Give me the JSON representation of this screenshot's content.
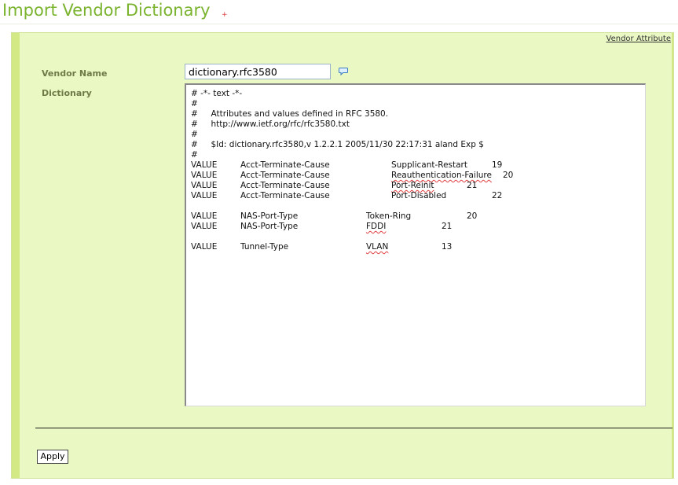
{
  "page": {
    "title": "Import Vendor Dictionary",
    "required_marker": "+"
  },
  "panel": {
    "vendor_attribute_link": "Vendor Attribute",
    "vendor_name_label": "Vendor Name",
    "vendor_name_value": "dictionary.rfc3580",
    "dictionary_label": "Dictionary",
    "dictionary_lines": [
      "# -*- text -*-",
      "#",
      "#     Attributes and values defined in RFC 3580.",
      "#     http://www.ietf.org/rfc/rfc3580.txt",
      "#",
      "#     $Id: dictionary.rfc3580,v 1.2.2.1 2005/11/30 22:17:31 aland Exp $",
      "#"
    ],
    "value_rows_terminate": [
      {
        "kw": "VALUE",
        "attr": "Acct-Terminate-Cause",
        "name": "Supplicant-Restart",
        "num": "19"
      },
      {
        "kw": "VALUE",
        "attr": "Acct-Terminate-Cause",
        "name": "Reauthentication-Failure",
        "num": "20"
      },
      {
        "kw": "VALUE",
        "attr": "Acct-Terminate-Cause",
        "name": "Port-Reinit",
        "num": "21"
      },
      {
        "kw": "VALUE",
        "attr": "Acct-Terminate-Cause",
        "name": "Port-Disabled",
        "num": "22"
      }
    ],
    "value_rows_nas": [
      {
        "kw": "VALUE",
        "attr": "NAS-Port-Type",
        "name": "Token-Ring",
        "num": "20"
      },
      {
        "kw": "VALUE",
        "attr": "NAS-Port-Type",
        "name": "FDDI",
        "num": "21"
      }
    ],
    "value_rows_tunnel": [
      {
        "kw": "VALUE",
        "attr": "Tunnel-Type",
        "name": "VLAN",
        "num": "13"
      }
    ],
    "apply_label": "Apply"
  },
  "colors": {
    "title_green": "#7ab32e",
    "panel_bg": "#eaf8c4",
    "panel_bar": "#d3e985",
    "label_olive": "#6f7a48"
  },
  "icons": {
    "comment": "speech-bubble-icon"
  }
}
